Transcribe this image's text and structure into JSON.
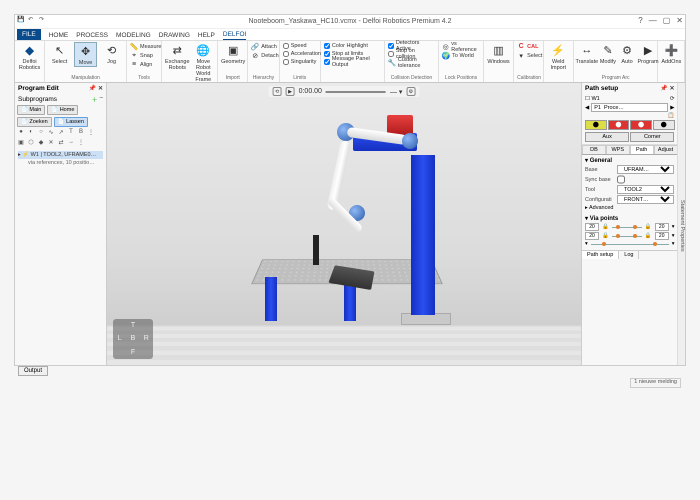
{
  "title": {
    "file": "Nooteboom_Yaskawa_HC10.vcmx",
    "app": "Delfoi Robotics Premium 4.2"
  },
  "wincontrols": {
    "min": "—",
    "max": "▢",
    "close": "✕",
    "help": "?",
    "opts": "–  ✕"
  },
  "tabs": {
    "file": "FILE",
    "items": [
      "HOME",
      "PROCESS",
      "MODELING",
      "DRAWING",
      "HELP",
      "DELFOI"
    ],
    "active": "DELFOI"
  },
  "ribbon": {
    "g1": {
      "label": "Delfoi Robotics",
      "btn": "Delfoi\nRobotics"
    },
    "g2": {
      "label": "Manipulation",
      "select": "Select",
      "move": "Move",
      "jog": "Jog"
    },
    "g3": {
      "label": "Tools",
      "measure": "Measure",
      "snap": "Snap",
      "align": "Align"
    },
    "g4": {
      "label": "",
      "exchange": "Exchange\nRobots",
      "moverobot": "Move Robot\nWorld Frame"
    },
    "g5": {
      "label": "Import",
      "geometry": "Geometry"
    },
    "g6": {
      "label": "Hierarchy",
      "attach": "Attach",
      "detach": "Detach"
    },
    "g7": {
      "label": "Limits",
      "speed": "Speed",
      "accel": "Acceleration",
      "sing": "Singularity"
    },
    "g8": {
      "label": "",
      "color": "Color Highlight",
      "stop": "Stop at limits",
      "msg": "Message Panel Output"
    },
    "g9": {
      "label": "Collision Detection",
      "da": "Detectors Active",
      "soc": "Stop on collision",
      "cust": "Custom tolerance"
    },
    "g10": {
      "label": "Lock Positions",
      "ref": "vs Reference",
      "world": "To World"
    },
    "g11": {
      "label": "",
      "windows": "Windows"
    },
    "g12": {
      "label": "Calibration",
      "cal": "CAL",
      "sel": "Select"
    },
    "g13": {
      "label": "",
      "weld": "Weld\nImport"
    },
    "g14": {
      "label": "Program Arc",
      "translate": "Translate",
      "modify": "Modify",
      "auto": "Auto",
      "program": "Program"
    },
    "g15": {
      "label": "",
      "addons": "AddOns"
    }
  },
  "left": {
    "title": "Program Edit",
    "subprograms_label": "Subprograms",
    "tabs": [
      "Main",
      "Home",
      "Zoeken",
      "Lassen"
    ],
    "tabs_active": "Lassen",
    "tree_root": "W1 | TOOL2, UFRAME0…",
    "tree_sub": "via references, 10 positio…"
  },
  "playback": {
    "time": "0:00.00",
    "reset": "⟲",
    "play": "▶"
  },
  "navcube": {
    "t": "T",
    "l": "L",
    "b": "B",
    "r": "R",
    "f": "F"
  },
  "right": {
    "sidetab": "Statement Properties",
    "pathsetup": "Path setup",
    "w1": "W1",
    "p1": "P1  Proce…",
    "aux": "Aux",
    "corner": "Corner",
    "tabs2": [
      "DB",
      "WPS",
      "Path",
      "Adjust"
    ],
    "tabs2_active": "Path",
    "general": "General",
    "base_lbl": "Base",
    "base_val": "UFRAM…",
    "sync_lbl": "Sync base",
    "tool_lbl": "Tool",
    "tool_val": "TOOL2",
    "cfg_lbl": "Configurati",
    "cfg_val": "FRONT…",
    "advanced": "Advanced",
    "via": "Via points",
    "via_vals": [
      "20",
      "20",
      "20",
      "20"
    ],
    "bottabs": [
      "Path setup",
      "Log"
    ],
    "bottabs_active": "Path setup"
  },
  "output": "Output",
  "status": "1 nieuwe melding"
}
